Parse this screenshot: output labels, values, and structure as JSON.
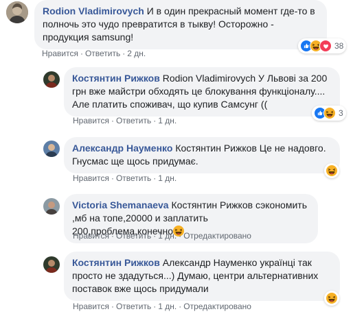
{
  "comments": [
    {
      "author": "Rodion Vladimirovych",
      "text": "И в один прекрасный момент где-то в полночь это чудо превратится в тыкву! Осторожно - продукция samsung!",
      "mention": "",
      "actions": {
        "like": "Нравится",
        "reply": "Ответить",
        "time": "2 дн.",
        "edited": ""
      },
      "reactions": {
        "types": [
          "like",
          "haha",
          "love"
        ],
        "count": "38"
      }
    },
    {
      "author": "Костянтин Рижков",
      "mention": "Rodion Vladimirovych",
      "text": "У Львові за 200 грн вже майстри обходять це блокування функціоналу.... Але платить споживач, що купив Самсунг ((",
      "actions": {
        "like": "Нравится",
        "reply": "Ответить",
        "time": "1 дн.",
        "edited": ""
      },
      "reactions": {
        "types": [
          "like",
          "haha"
        ],
        "count": "3"
      }
    },
    {
      "author": "Александр Науменко",
      "mention": "Костянтин Рижков",
      "text": "Це не надовго. Гнусмас ще щось придумає.",
      "actions": {
        "like": "Нравится",
        "reply": "Ответить",
        "time": "1 дн.",
        "edited": ""
      },
      "reactions": {
        "types": [
          "haha"
        ],
        "count": ""
      }
    },
    {
      "author": "Victoria Shemanaeva",
      "mention": "Костянтин Рижков",
      "text": "сэкономить ,мб на топе,20000 и заплатить 200,проблема,конечно",
      "actions": {
        "like": "Нравится",
        "reply": "Ответить",
        "time": "1 дн.",
        "edited": "Отредактировано"
      },
      "reactions": {
        "types": [],
        "count": ""
      }
    },
    {
      "author": "Костянтин Рижков",
      "mention": "Александр Науменко",
      "text": "українці так просто не здадуться...) Думаю, центри альтернативних поставок вже щось придумали",
      "actions": {
        "like": "Нравится",
        "reply": "Ответить",
        "time": "1 дн.",
        "edited": "Отредактировано"
      },
      "reactions": {
        "types": [
          "haha"
        ],
        "count": ""
      }
    }
  ],
  "separator": "·",
  "colors": {
    "link": "#385898",
    "bubble": "#f2f3f5",
    "meta": "#606770",
    "like": "#1877f2",
    "haha": "#f7b125",
    "love": "#f33e58"
  },
  "icons": {
    "like": "thumbs-up-icon",
    "haha": "laughing-face-icon",
    "love": "heart-icon"
  }
}
